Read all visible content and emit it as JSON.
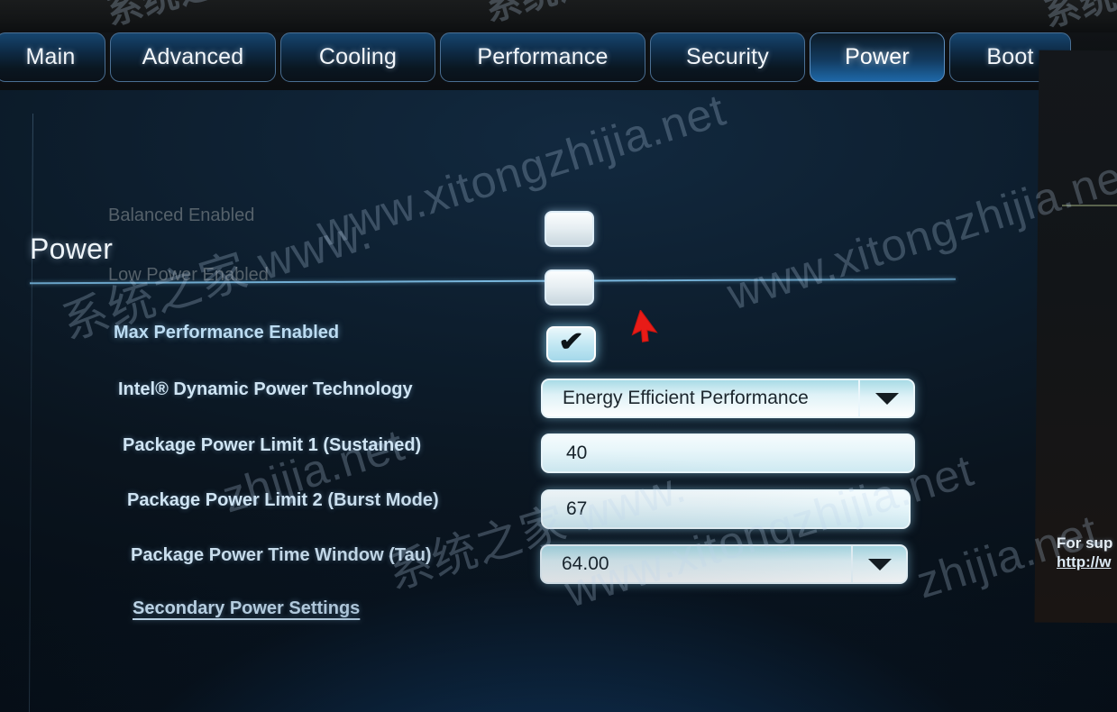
{
  "tabs": [
    {
      "label": "Main",
      "active": false
    },
    {
      "label": "Advanced",
      "active": false
    },
    {
      "label": "Cooling",
      "active": false
    },
    {
      "label": "Performance",
      "active": false
    },
    {
      "label": "Security",
      "active": false
    },
    {
      "label": "Power",
      "active": true
    },
    {
      "label": "Boot",
      "active": false
    }
  ],
  "page": {
    "title": "Power"
  },
  "settings": {
    "balanced": {
      "label": "Balanced Enabled",
      "state": "disabled",
      "checked": false
    },
    "low_power": {
      "label": "Low Power Enabled",
      "state": "disabled",
      "checked": false
    },
    "max_performance": {
      "label": "Max Performance Enabled",
      "state": "enabled",
      "checked": true,
      "tick": "✔"
    },
    "dynamic_power": {
      "label": "Intel® Dynamic Power Technology",
      "value": "Energy Efficient Performance"
    },
    "ppl1": {
      "label": "Package Power Limit 1 (Sustained)",
      "value": "40"
    },
    "ppl2": {
      "label": "Package Power Limit 2 (Burst Mode)",
      "value": "67"
    },
    "tau": {
      "label": "Package Power Time Window (Tau)",
      "value": "64.00"
    },
    "secondary_link": {
      "label": "Secondary Power Settings"
    }
  },
  "help_panel": {
    "support_text": "For sup",
    "support_link": "http://w"
  },
  "watermarks": {
    "cn": "系统之家",
    "url": "www.xitongzhijia.net",
    "url_short": "www.xitong",
    "url_frag_net": "net",
    "url_frag_zhijia": "zhijia.net",
    "cn_url": "系统之家 www."
  },
  "colors": {
    "accent_blue": "#1e68a8",
    "panel_blue": "#12293f",
    "field_cyan": "#cfeaf2",
    "label_enabled": "#bcdcf2",
    "label_disabled": "#55616a",
    "cursor_red": "#e81b17"
  }
}
